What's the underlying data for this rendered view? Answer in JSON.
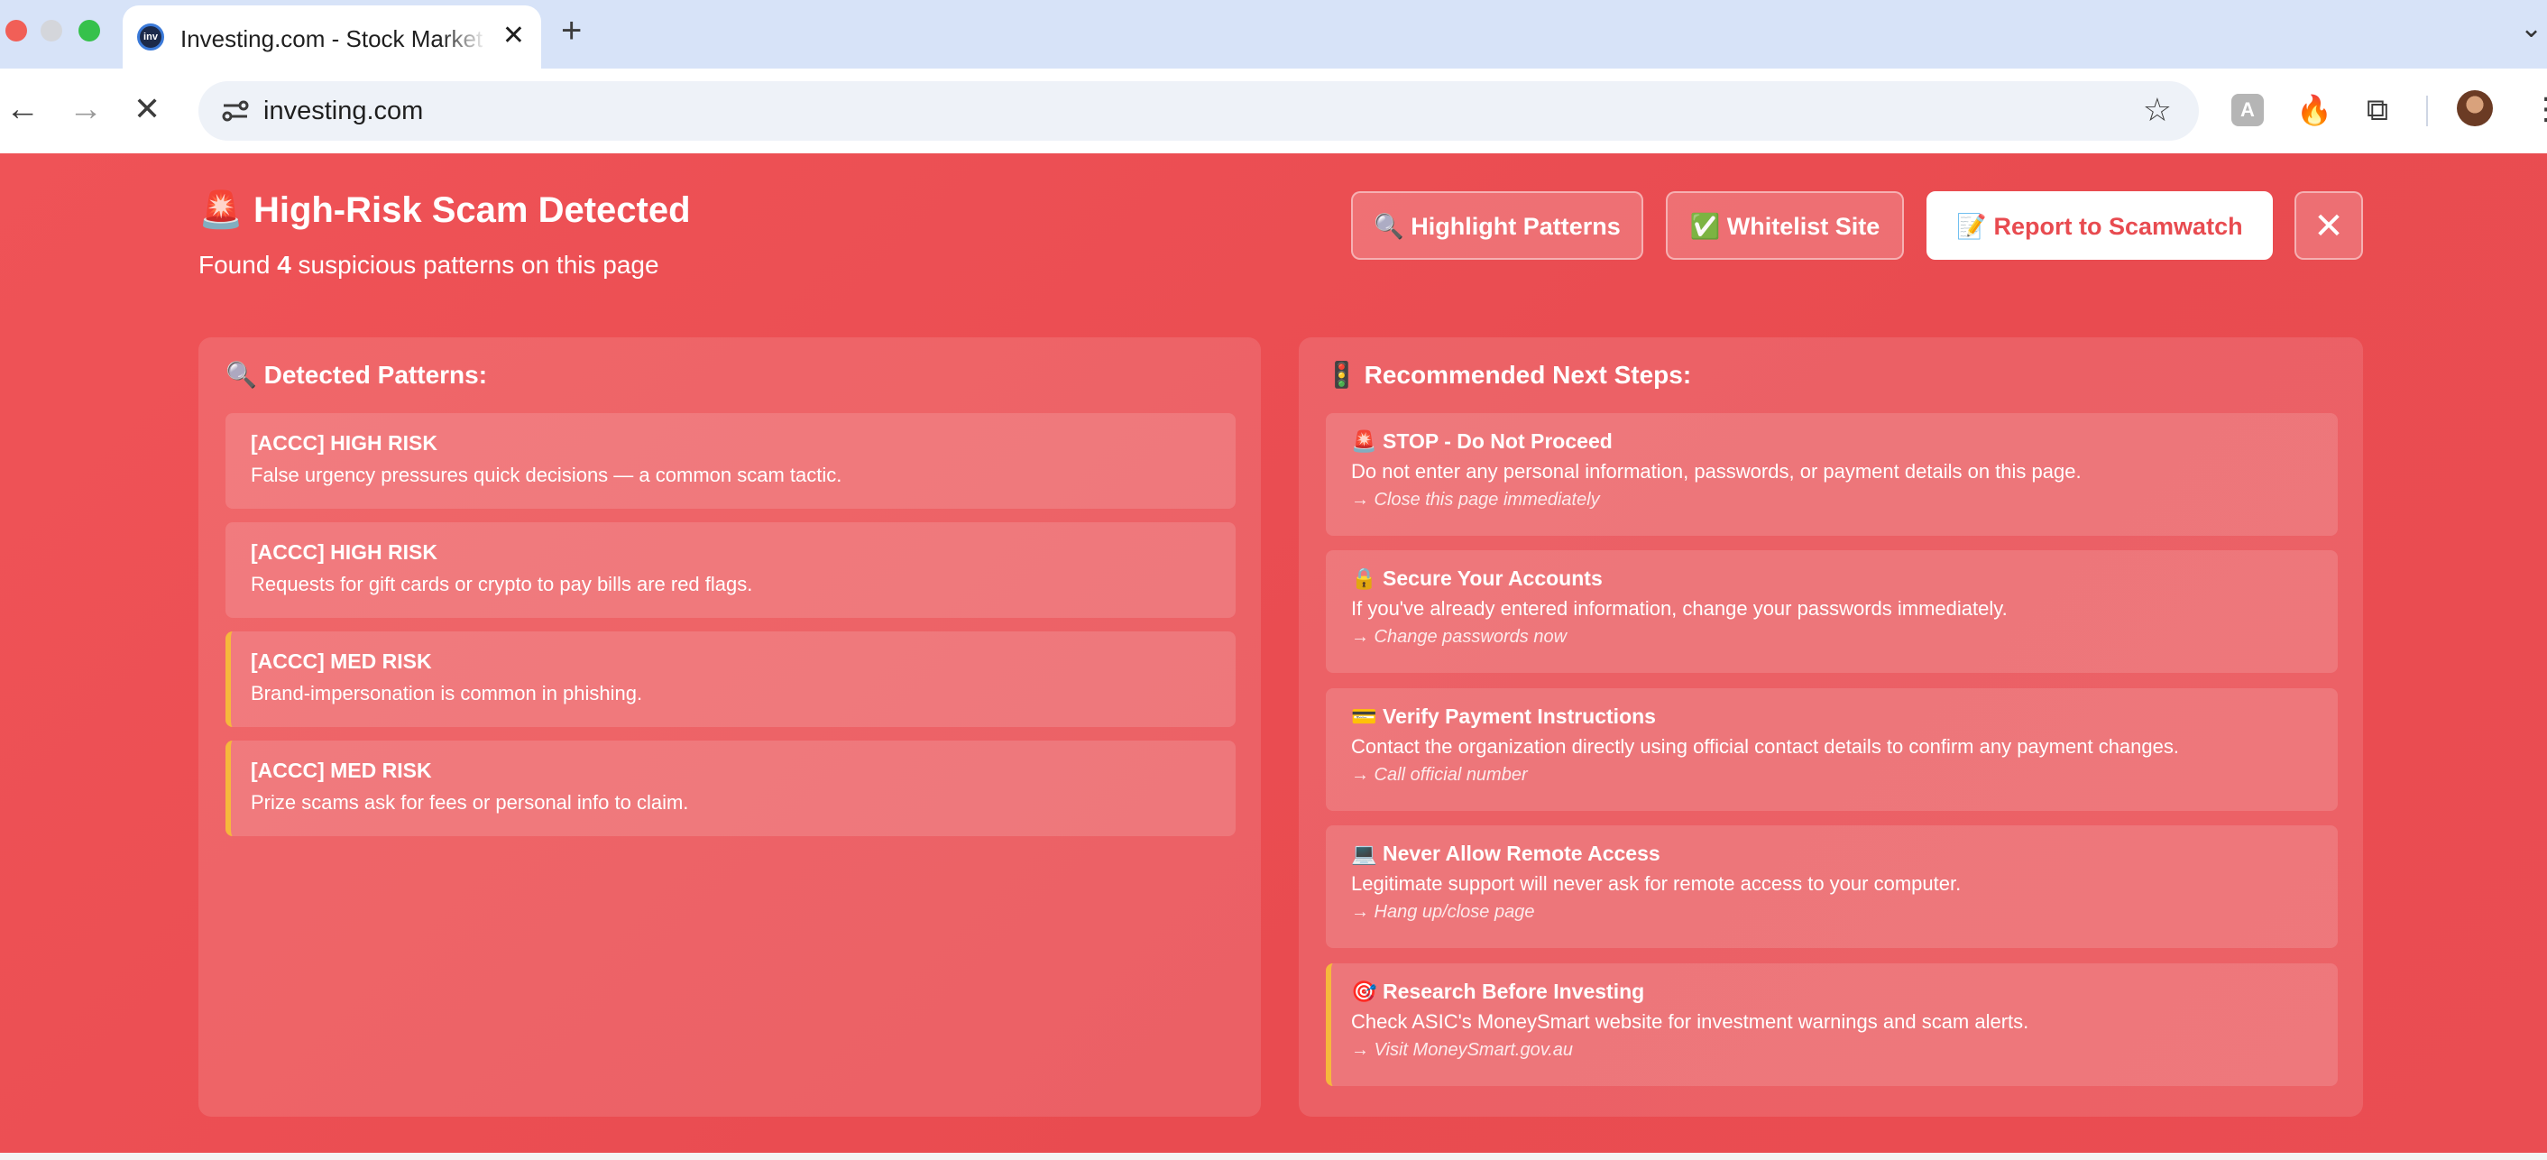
{
  "browser": {
    "tab_title": "Investing.com - Stock Market Quotes & Financial News",
    "favicon_text": "inv",
    "url": "investing.com"
  },
  "alert": {
    "title_icon": "🚨",
    "title": "High-Risk Scam Detected",
    "subtitle_prefix": "Found",
    "pattern_count": "4",
    "subtitle_suffix": "suspicious patterns on this page",
    "buttons": {
      "highlight": "🔍 Highlight Patterns",
      "whitelist": "✅ Whitelist Site",
      "report": "📝 Report to Scamwatch",
      "close": "✕"
    }
  },
  "patterns": {
    "heading": "🔍 Detected Patterns:",
    "items": [
      {
        "level": "high",
        "title": "[ACCC] HIGH RISK",
        "text": "False urgency pressures quick decisions — a common scam tactic."
      },
      {
        "level": "high",
        "title": "[ACCC] HIGH RISK",
        "text": "Requests for gift cards or crypto to pay bills are red flags."
      },
      {
        "level": "med",
        "title": "[ACCC] MED RISK",
        "text": "Brand-impersonation is common in phishing."
      },
      {
        "level": "med",
        "title": "[ACCC] MED RISK",
        "text": "Prize scams ask for fees or personal info to claim."
      }
    ]
  },
  "steps": {
    "heading": "🚦 Recommended Next Steps:",
    "items": [
      {
        "icon": "🚨",
        "title": "STOP - Do Not Proceed",
        "text": "Do not enter any personal information, passwords, or payment details on this page.",
        "action": "→ Close this page immediately"
      },
      {
        "icon": "🔒",
        "title": "Secure Your Accounts",
        "text": "If you've already entered information, change your passwords immediately.",
        "action": "→ Change passwords now"
      },
      {
        "icon": "💳",
        "title": "Verify Payment Instructions",
        "text": "Contact the organization directly using official contact details to confirm any payment changes.",
        "action": "→ Call official number"
      },
      {
        "icon": "💻",
        "title": "Never Allow Remote Access",
        "text": "Legitimate support will never ask for remote access to your computer.",
        "action": "→ Hang up/close page"
      },
      {
        "icon": "🎯",
        "title": "Research Before Investing",
        "text": "Check ASIC's MoneySmart website for investment warnings and scam alerts.",
        "action": "→ Visit MoneySmart.gov.au"
      }
    ]
  },
  "colors": {
    "overlay_bg": "#ec4f54",
    "report_text": "#e84b50",
    "med_risk_border": "#f6b83c"
  }
}
